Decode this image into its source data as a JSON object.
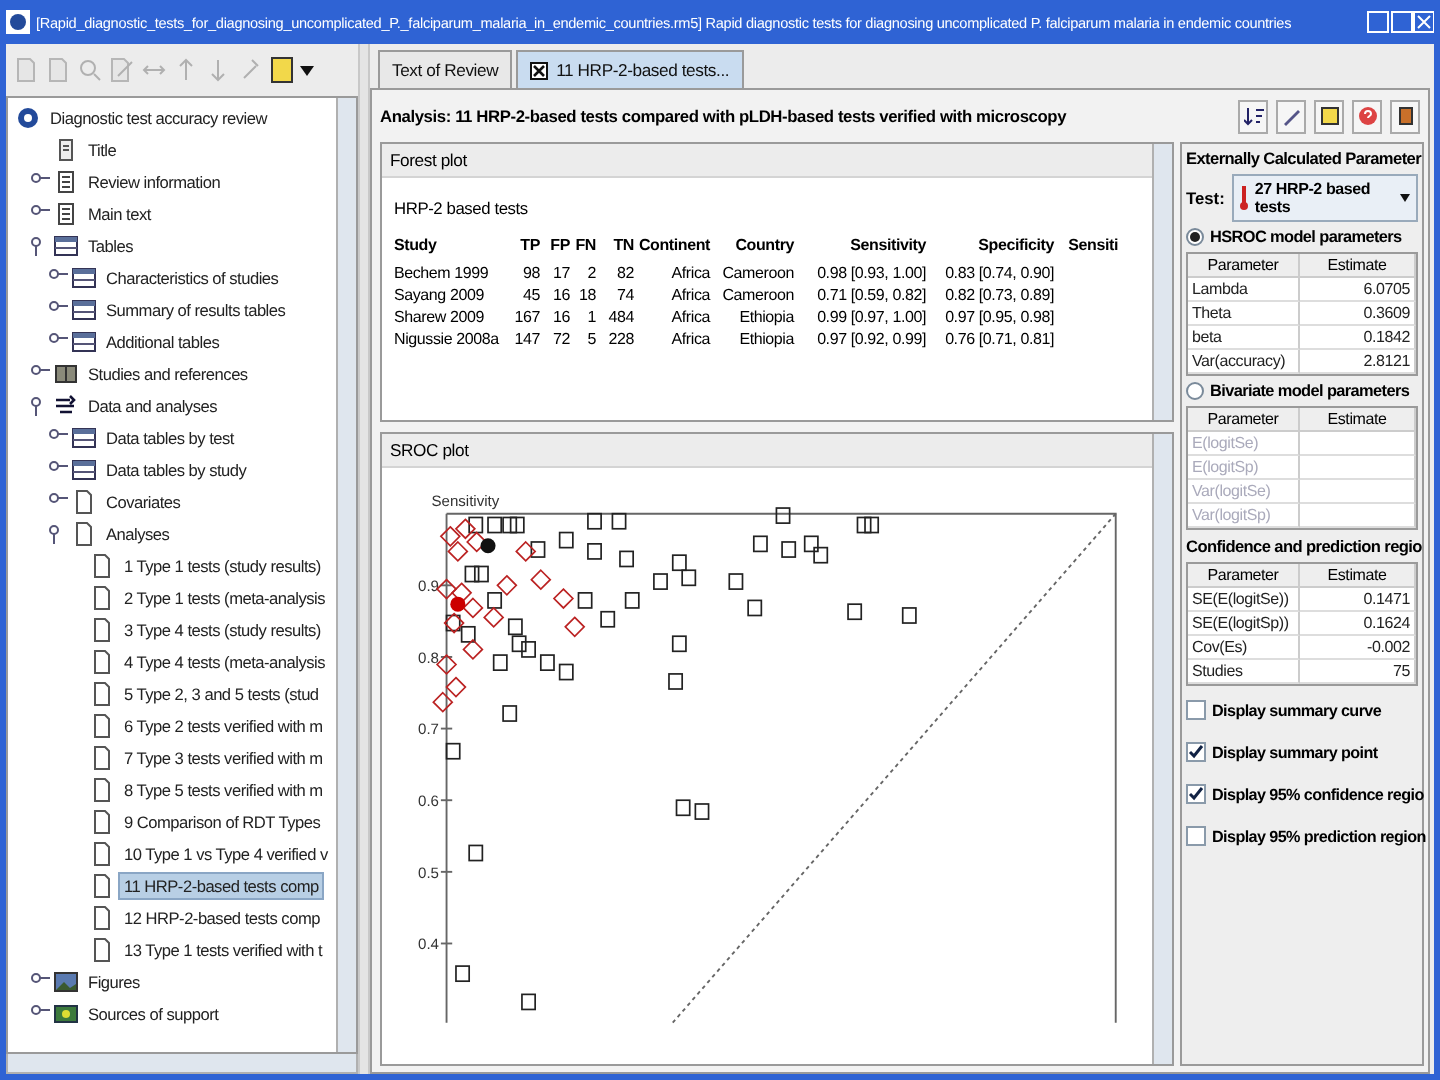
{
  "window": {
    "title": "[Rapid_diagnostic_tests_for_diagnosing_uncomplicated_P._falciparum_malaria_in_endemic_countries.rm5] Rapid diagnostic tests for diagnosing uncomplicated P. falciparum malaria in endemic countries"
  },
  "toolbar": [
    {
      "kind": "page",
      "disabled": true
    },
    {
      "kind": "page",
      "disabled": true
    },
    {
      "kind": "search",
      "disabled": true
    },
    {
      "kind": "edit",
      "disabled": true
    },
    {
      "kind": "link",
      "disabled": true
    },
    {
      "kind": "up",
      "disabled": true
    },
    {
      "kind": "down",
      "disabled": true
    },
    {
      "kind": "pin",
      "disabled": true
    },
    {
      "kind": "note",
      "disabled": false
    }
  ],
  "tree": {
    "items": [
      {
        "label": "Diagnostic test accuracy review",
        "kind": "review",
        "selected": false,
        "children": [
          {
            "label": "Title",
            "kind": "page",
            "selected": false
          },
          {
            "label": "Review information",
            "kind": "list",
            "expanded": false,
            "selected": false
          },
          {
            "label": "Main text",
            "kind": "list",
            "expanded": false,
            "selected": false
          },
          {
            "label": "Tables",
            "kind": "table",
            "expanded": true,
            "selected": false,
            "children": [
              {
                "label": "Characteristics of studies",
                "kind": "table",
                "expanded": false,
                "selected": false
              },
              {
                "label": "Summary of results tables",
                "kind": "table",
                "expanded": false,
                "selected": false
              },
              {
                "label": "Additional tables",
                "kind": "table",
                "expanded": false,
                "selected": false
              }
            ]
          },
          {
            "label": "Studies and references",
            "kind": "book",
            "expanded": false,
            "selected": false
          },
          {
            "label": "Data and analyses",
            "kind": "flow",
            "expanded": true,
            "selected": false,
            "children": [
              {
                "label": "Data tables by test",
                "kind": "table",
                "expanded": false,
                "selected": false
              },
              {
                "label": "Data tables by study",
                "kind": "table",
                "expanded": false,
                "selected": false
              },
              {
                "label": "Covariates",
                "kind": "doc",
                "expanded": false,
                "selected": false
              },
              {
                "label": "Analyses",
                "kind": "doc",
                "expanded": true,
                "selected": false,
                "children": [
                  {
                    "label": "1 Type 1 tests (study results)",
                    "kind": "doc",
                    "selected": false
                  },
                  {
                    "label": "2 Type 1 tests (meta-analysis",
                    "kind": "doc",
                    "selected": false
                  },
                  {
                    "label": "3 Type 4 tests (study results)",
                    "kind": "doc",
                    "selected": false
                  },
                  {
                    "label": "4 Type 4 tests (meta-analysis",
                    "kind": "doc",
                    "selected": false
                  },
                  {
                    "label": "5 Type 2, 3 and 5 tests (stud",
                    "kind": "doc",
                    "selected": false
                  },
                  {
                    "label": "6 Type 2 tests verified with m",
                    "kind": "doc",
                    "selected": false
                  },
                  {
                    "label": "7 Type 3 tests verified with m",
                    "kind": "doc",
                    "selected": false
                  },
                  {
                    "label": "8 Type 5 tests verified with m",
                    "kind": "doc",
                    "selected": false
                  },
                  {
                    "label": "9 Comparison of RDT Types",
                    "kind": "doc",
                    "selected": false
                  },
                  {
                    "label": "10 Type 1 vs Type 4 verified v",
                    "kind": "doc",
                    "selected": false
                  },
                  {
                    "label": "11 HRP-2-based tests comp",
                    "kind": "doc",
                    "selected": true
                  },
                  {
                    "label": "12 HRP-2-based tests comp",
                    "kind": "doc",
                    "selected": false
                  },
                  {
                    "label": "13 Type 1 tests verified with t",
                    "kind": "doc",
                    "selected": false
                  }
                ]
              }
            ]
          },
          {
            "label": "Figures",
            "kind": "image",
            "expanded": false,
            "selected": false
          },
          {
            "label": "Sources of support",
            "kind": "support",
            "expanded": false,
            "selected": false
          }
        ]
      }
    ]
  },
  "tabs": [
    {
      "label": "Text of Review",
      "selected": false,
      "closable": false
    },
    {
      "label": "11 HRP-2-based tests...",
      "selected": true,
      "closable": true
    }
  ],
  "analysis": {
    "title": "Analysis: 11 HRP-2-based tests compared with pLDH-based tests verified with microscopy"
  },
  "forest_plot": {
    "title": "Forest plot",
    "subtitle": "HRP-2 based tests",
    "columns": [
      "Study",
      "TP",
      "FP",
      "FN",
      "TN",
      "Continent",
      "Country",
      "Sensitivity",
      "Specificity",
      "Sensiti"
    ],
    "rows": [
      [
        "Bechem 1999",
        "98",
        "17",
        "2",
        "82",
        "Africa",
        "Cameroon",
        "0.98 [0.93, 1.00]",
        "0.83 [0.74, 0.90]"
      ],
      [
        "Sayang 2009",
        "45",
        "16",
        "18",
        "74",
        "Africa",
        "Cameroon",
        "0.71 [0.59, 0.82]",
        "0.82 [0.73, 0.89]"
      ],
      [
        "Sharew 2009",
        "167",
        "16",
        "1",
        "484",
        "Africa",
        "Ethiopia",
        "0.99 [0.97, 1.00]",
        "0.97 [0.95, 0.98]"
      ],
      [
        "Nigussie 2008a",
        "147",
        "72",
        "5",
        "228",
        "Africa",
        "Ethiopia",
        "0.97 [0.92, 0.99]",
        "0.76 [0.71, 0.81]"
      ]
    ]
  },
  "sroc_plot": {
    "title": "SROC plot",
    "ylabel": "Sensitivity",
    "yticks": [
      "0.9",
      "0.8",
      "0.7",
      "0.6",
      "0.5",
      "0.4"
    ]
  },
  "parameters": {
    "title": "Externally Calculated Parameter",
    "test_label": "Test:",
    "test_value": "27 HRP-2 based tests",
    "models": [
      {
        "label": "HSROC model parameters",
        "selected": true,
        "columns": [
          "Parameter",
          "Estimate"
        ],
        "rows": [
          [
            "Lambda",
            "6.0705"
          ],
          [
            "Theta",
            "0.3609"
          ],
          [
            "beta",
            "0.1842"
          ],
          [
            "Var(accuracy)",
            "2.8121"
          ]
        ]
      },
      {
        "label": "Bivariate model parameters",
        "selected": false,
        "columns": [
          "Parameter",
          "Estimate"
        ],
        "rows": [
          [
            "E(logitSe)"
          ],
          [
            "E(logitSp)"
          ],
          [
            "Var(logitSe)"
          ],
          [
            "Var(logitSp)"
          ]
        ]
      }
    ],
    "regions": {
      "title": "Confidence and prediction regio",
      "columns": [
        "Parameter",
        "Estimate"
      ],
      "rows": [
        [
          "SE(E(logitSe))",
          "0.1471"
        ],
        [
          "SE(E(logitSp))",
          "0.1624"
        ],
        [
          "Cov(Es)",
          "-0.002"
        ],
        [
          "Studies",
          "75"
        ]
      ]
    },
    "options": [
      {
        "label": "Display summary curve",
        "checked": false
      },
      {
        "label": "Display summary point",
        "checked": true
      },
      {
        "label": "Display 95% confidence regio",
        "checked": true
      },
      {
        "label": "Display 95% prediction region",
        "checked": false
      }
    ]
  }
}
